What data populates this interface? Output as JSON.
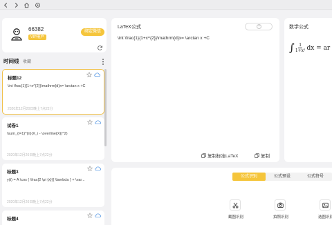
{
  "colors": {
    "accent": "#f5c53b",
    "background": "#f2f2f4",
    "card_border_active": "#f0c14b"
  },
  "topbar": {
    "back_icon": "chevron-left-icon",
    "forward_icon": "chevron-right-icon",
    "home_icon": "home-icon",
    "settings_icon": "gear-icon"
  },
  "profile": {
    "user_id": "66382",
    "badge": "VIP用户",
    "bind_button": "绑定微信",
    "refresh_icon": "refresh-icon"
  },
  "timeline": {
    "title": "时间线",
    "favorites_link": "收藏",
    "items": [
      {
        "title": "标题12",
        "formula": "\\int \\frac{1}{1+x^{2}}\\mathrm{d}x= \\arctan x +C",
        "time": "2020年12月20日晚上7点22分"
      },
      {
        "title": "试卷1",
        "formula": "\\sum_{i=1}^{n}(X_i - \\overline{X})^2)",
        "time": "2020年12月20日晚上7点22分"
      },
      {
        "title": "标题3",
        "formula": "y(t) = A \\cos ( \\frac{2 \\pi {x}}{ \\lambda } + \\var...",
        "time": "2020年12月20日晚上7点22分"
      },
      {
        "title": "标题4",
        "formula": "",
        "time": ""
      }
    ]
  },
  "editor": {
    "title": "LaTeX公式",
    "content": "\\int \\frac{1}{1+x^{2}}\\mathrm{d}x= \\arctan x +C",
    "copy_standard_label": "复制标准LaTeX",
    "copy_label": "复制"
  },
  "preview": {
    "title": "数学公式",
    "integral": "∫",
    "numerator": "1",
    "denominator": "1+x²",
    "expr": "dx = ar"
  },
  "modes": {
    "tabs": [
      "公式识别",
      "公式预设",
      "公式符号"
    ],
    "active_index": 0
  },
  "tools": [
    {
      "label": "截图识别",
      "icon": "scissors-icon"
    },
    {
      "label": "拍照识别",
      "icon": "camera-icon"
    },
    {
      "label": "选图识别",
      "icon": "image-icon"
    }
  ]
}
